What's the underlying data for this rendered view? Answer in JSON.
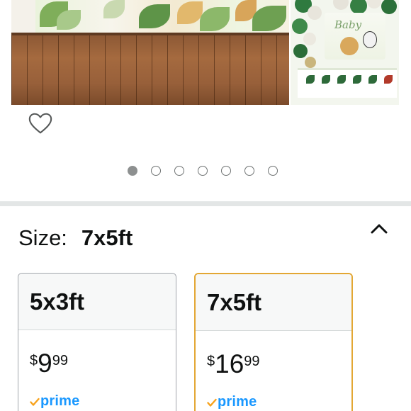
{
  "carousel": {
    "image_count": 7,
    "active_index": 0,
    "side_photo_text": "Baby"
  },
  "size_selector": {
    "label": "Size:",
    "selected_value": "7x5ft",
    "collapse_icon": "chevron-up-icon",
    "options": [
      {
        "name": "5x3ft",
        "price_symbol": "$",
        "price_whole": "9",
        "price_fraction": "99",
        "prime": "prime",
        "selected": false
      },
      {
        "name": "7x5ft",
        "price_symbol": "$",
        "price_whole": "16",
        "price_fraction": "99",
        "prime": "prime",
        "selected": true
      }
    ]
  },
  "colors": {
    "selected_border": "#e3a734",
    "unselected_border": "#a2a6ac",
    "prime_blue": "#1a98ff",
    "prime_check": "#f7a21c",
    "divider": "#e3e6e6"
  }
}
